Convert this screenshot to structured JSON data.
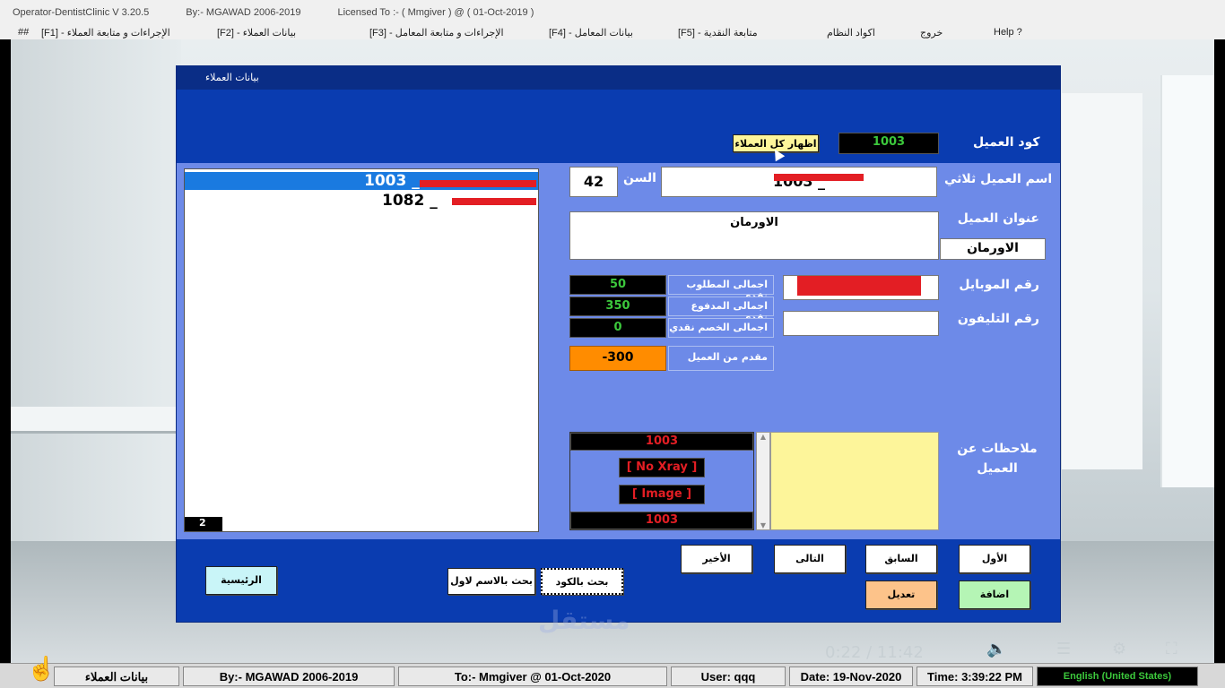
{
  "titlebar": {
    "app": "Operator-DentistClinic V 3.20.5",
    "by": "By:- MGAWAD 2006-2019",
    "licensed": "Licensed To :- ( Mmgiver ) @ ( 01-Oct-2019 )"
  },
  "menu": {
    "hash": "##",
    "f1": "[F1] - الإجراءات و متابعة العملاء",
    "f2": "[F2] - بيانات العملاء",
    "f3": "[F3] - الإجراءات و متابعة المعامل",
    "f4": "[F4] - بيانات المعامل",
    "f5": "[F5] - متابعة النقدية",
    "codes": "اكواد النظام",
    "exit": "خروج",
    "help": "Help ?"
  },
  "form": {
    "title": "بيانات العملاء",
    "customer_code_label": "كود العميل",
    "customer_code": "1003",
    "show_all_button": "اظهار كل العملاء",
    "name_label": "اسم العميل ثلاثي",
    "name_value": "1003 _",
    "age_label": "السن",
    "age": "42",
    "address_label": "عنوان العميل",
    "address": "الاورمان",
    "address_short": "الاورمان",
    "mobile_label": "رقم الموبايل",
    "phone_label": "رقم التليفون",
    "notes_label": "ملاحظات عن العميل",
    "totals": [
      {
        "label": "اجمالى المطلوب نقدي",
        "value": "50"
      },
      {
        "label": "اجمالى المدفوع نقدي",
        "value": "350"
      },
      {
        "label": "اجمالى الخصم نقدي",
        "value": "0"
      }
    ],
    "advance_label": "مقدم من العميل",
    "advance": "-300",
    "xray_code_top": "1003",
    "no_xray": "[ No Xray ]",
    "image": "[ Image ]",
    "xray_code_bottom": "1003",
    "list": [
      {
        "text": "1003 _"
      },
      {
        "text": "1082 _"
      }
    ],
    "list_count": "2"
  },
  "buttons": {
    "first": "الأول",
    "prev": "السابق",
    "next": "التالى",
    "last": "الأخير",
    "add": "اضافة",
    "edit": "تعديل",
    "search_code": "بحث بالكود",
    "search_name": "بحث بالاسم لاول",
    "home": "الرئيسية"
  },
  "statusbar": {
    "screen": "بيانات العملاء",
    "by": "By:- MGAWAD 2006-2019",
    "to": "To:- Mmgiver @ 01-Oct-2020",
    "user": "User: qqq",
    "date": "Date: 19-Nov-2020",
    "time": "Time: 3:39:22 PM",
    "lang": "English (United States)"
  },
  "overlay": {
    "video_time": "0:22 / 11:42",
    "watermark": "مستقل"
  },
  "colors": {
    "form_bg": "#0a3cb0",
    "panel": "#6d8ae8",
    "green_value": "#3cc83c",
    "red_value": "#e31e24",
    "advance_bg": "#ff8c00",
    "notes_bg": "#fdf59a"
  }
}
